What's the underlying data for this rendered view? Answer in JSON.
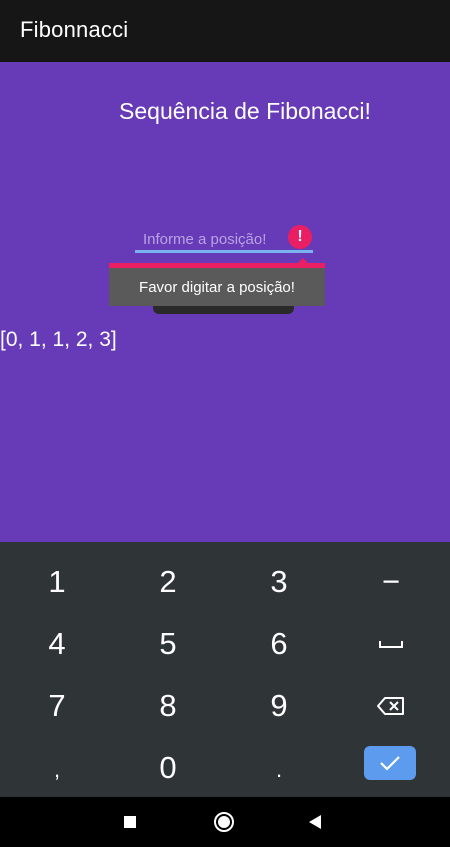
{
  "app_bar": {
    "title": "Fibonnacci"
  },
  "main": {
    "heading": "Sequência de Fibonacci!",
    "input": {
      "placeholder": "Informe a posição!",
      "value": ""
    },
    "error": {
      "icon": "!",
      "message": "Favor digitar a posição!"
    },
    "result": "[0, 1, 1, 2, 3]"
  },
  "keyboard": {
    "rows": [
      [
        "1",
        "2",
        "3",
        "−"
      ],
      [
        "4",
        "5",
        "6",
        "␣"
      ],
      [
        "7",
        "8",
        "9",
        "backspace"
      ],
      [
        ",",
        "0",
        ".",
        "done"
      ]
    ],
    "k1": "1",
    "k2": "2",
    "k3": "3",
    "minus": "−",
    "k4": "4",
    "k5": "5",
    "k6": "6",
    "k7": "7",
    "k8": "8",
    "k9": "9",
    "comma": ",",
    "k0": "0",
    "period": "."
  },
  "nav": {
    "recents": "square-icon",
    "home": "circle-icon",
    "back": "triangle-back-icon"
  },
  "colors": {
    "app_bar": "#161616",
    "content_bg": "#673ab7",
    "error": "#e91e63",
    "underline": "#7ab3f0",
    "keyboard_bg": "#2f3437",
    "done_key": "#5c9bed"
  }
}
